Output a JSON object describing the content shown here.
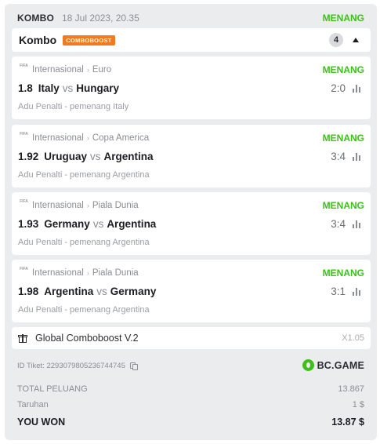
{
  "header": {
    "type": "KOMBO",
    "date": "18 Jul 2023, 20.35",
    "status": "MENANG"
  },
  "kombo": {
    "title": "Kombo",
    "badge": "COMBOBOOST",
    "count": "4"
  },
  "matches": [
    {
      "category": "Internasional",
      "league": "Euro",
      "status": "MENANG",
      "odds": "1.8",
      "home": "Italy",
      "vs": "vs",
      "away": "Hungary",
      "score": "2:0",
      "market": "Adu Penalti - pemenang Italy"
    },
    {
      "category": "Internasional",
      "league": "Copa America",
      "status": "MENANG",
      "odds": "1.92",
      "home": "Uruguay",
      "vs": "vs",
      "away": "Argentina",
      "score": "3:4",
      "market": "Adu Penalti - pemenang Argentina"
    },
    {
      "category": "Internasional",
      "league": "Piala Dunia",
      "status": "MENANG",
      "odds": "1.93",
      "home": "Germany",
      "vs": "vs",
      "away": "Argentina",
      "score": "3:4",
      "market": "Adu Penalti - pemenang Argentina"
    },
    {
      "category": "Internasional",
      "league": "Piala Dunia",
      "status": "MENANG",
      "odds": "1.98",
      "home": "Argentina",
      "vs": "vs",
      "away": "Germany",
      "score": "3:1",
      "market": "Adu Penalti - pemenang Argentina"
    }
  ],
  "league_icon_text": "FIFA",
  "boost": {
    "name": "Global Comboboost V.2",
    "multiplier": "X1.05"
  },
  "ticket": {
    "id_label": "ID Tiket: 2293079805236744745",
    "brand": "BC.GAME"
  },
  "summary": {
    "total_odds_label": "TOTAL PELUANG",
    "total_odds_value": "13.867",
    "stake_label": "Taruhan",
    "stake_value": "1 $",
    "won_label": "YOU WON",
    "won_value": "13.87 $"
  },
  "colors": {
    "win_green": "#3bc117",
    "badge_orange": "#f27b22",
    "panel_bg": "#ebecee",
    "card_bg": "#ffffff"
  }
}
